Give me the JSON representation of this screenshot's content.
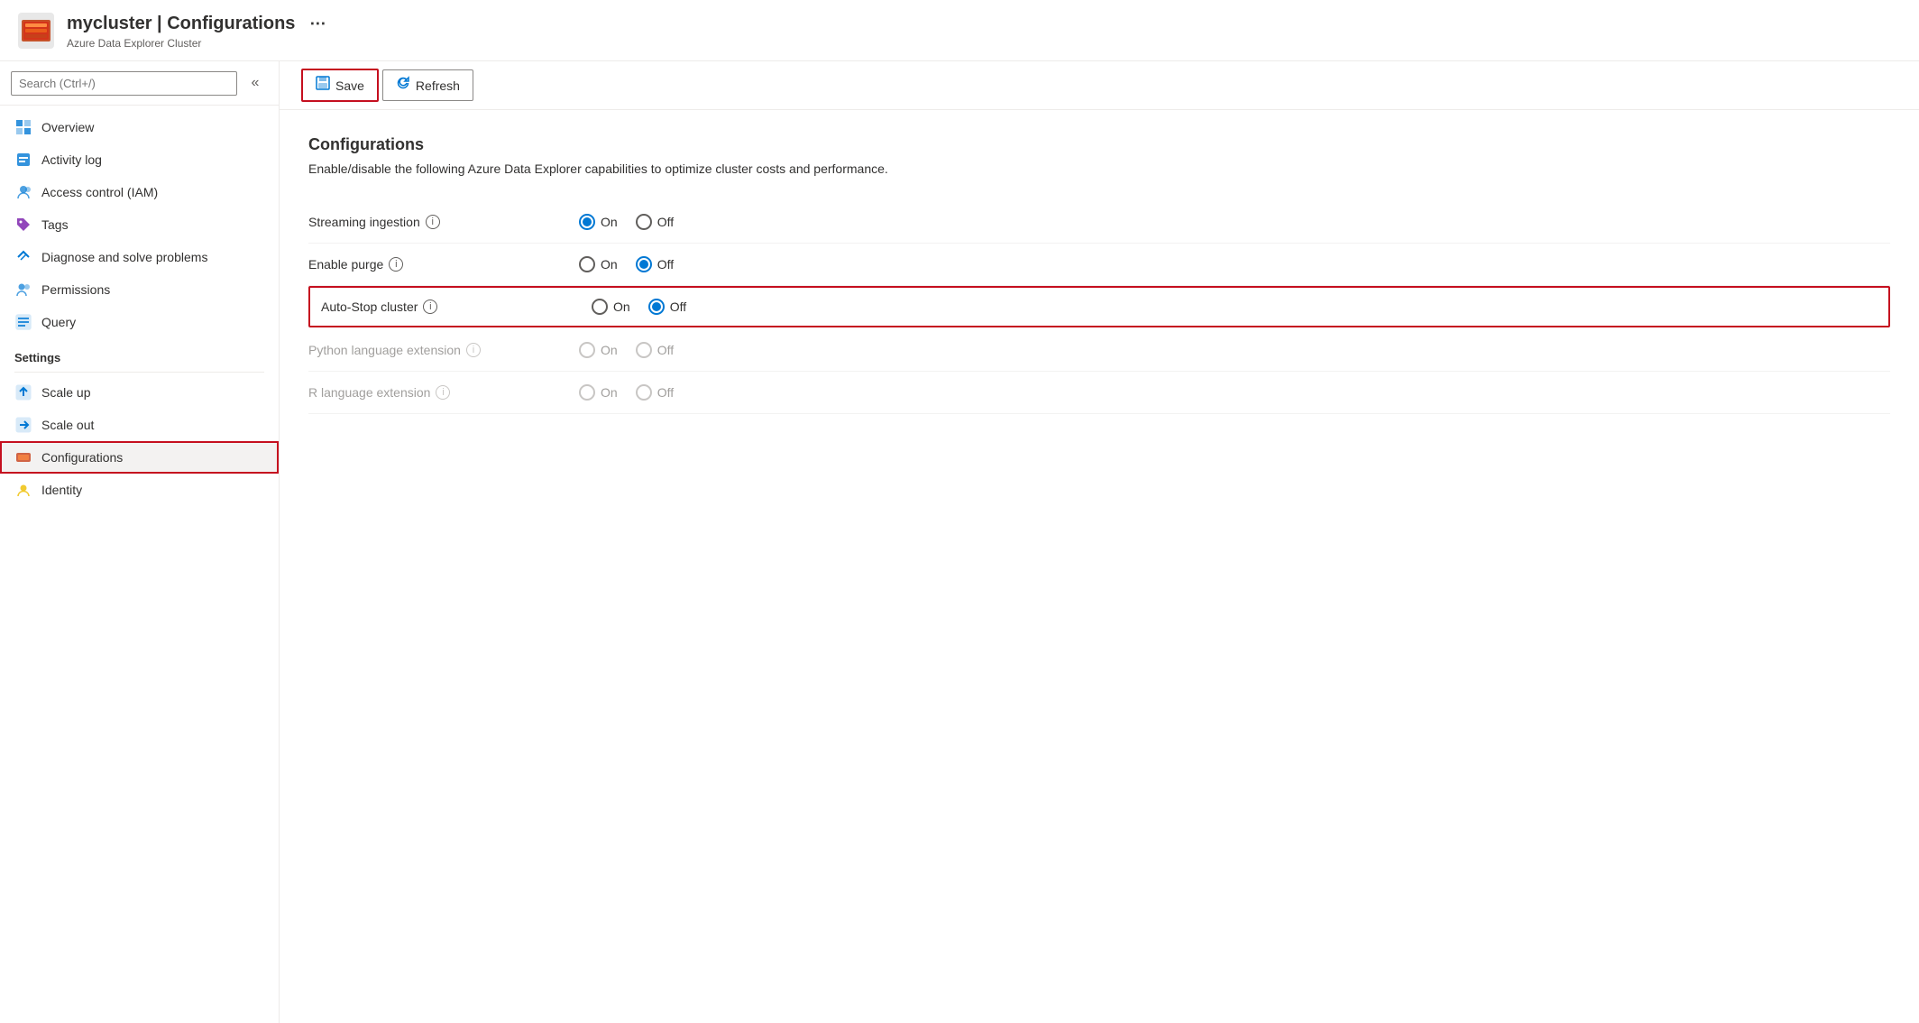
{
  "header": {
    "title": "mycluster | Configurations",
    "subtitle": "Azure Data Explorer Cluster",
    "more_icon": "⋯"
  },
  "sidebar": {
    "search_placeholder": "Search (Ctrl+/)",
    "collapse_icon": "«",
    "nav_items": [
      {
        "id": "overview",
        "label": "Overview",
        "icon": "overview"
      },
      {
        "id": "activity-log",
        "label": "Activity log",
        "icon": "activity"
      },
      {
        "id": "access-control",
        "label": "Access control (IAM)",
        "icon": "access"
      },
      {
        "id": "tags",
        "label": "Tags",
        "icon": "tags"
      },
      {
        "id": "diagnose",
        "label": "Diagnose and solve problems",
        "icon": "diagnose"
      },
      {
        "id": "permissions",
        "label": "Permissions",
        "icon": "permissions"
      },
      {
        "id": "query",
        "label": "Query",
        "icon": "query"
      }
    ],
    "settings_label": "Settings",
    "settings_items": [
      {
        "id": "scale-up",
        "label": "Scale up",
        "icon": "scale-up"
      },
      {
        "id": "scale-out",
        "label": "Scale out",
        "icon": "scale-out"
      },
      {
        "id": "configurations",
        "label": "Configurations",
        "icon": "configurations",
        "active": true
      },
      {
        "id": "identity",
        "label": "Identity",
        "icon": "identity"
      }
    ]
  },
  "toolbar": {
    "save_label": "Save",
    "refresh_label": "Refresh"
  },
  "config": {
    "title": "Configurations",
    "description": "Enable/disable the following Azure Data Explorer capabilities to optimize cluster costs and performance.",
    "rows": [
      {
        "id": "streaming-ingestion",
        "label": "Streaming ingestion",
        "has_info": true,
        "on_selected": true,
        "off_selected": false,
        "disabled": false
      },
      {
        "id": "enable-purge",
        "label": "Enable purge",
        "has_info": true,
        "on_selected": false,
        "off_selected": true,
        "disabled": false
      },
      {
        "id": "auto-stop",
        "label": "Auto-Stop cluster",
        "has_info": true,
        "on_selected": false,
        "off_selected": true,
        "disabled": false,
        "highlighted": true
      },
      {
        "id": "python-extension",
        "label": "Python language extension",
        "has_info": true,
        "on_selected": false,
        "off_selected": false,
        "disabled": true
      },
      {
        "id": "r-extension",
        "label": "R language extension",
        "has_info": true,
        "on_selected": false,
        "off_selected": false,
        "disabled": true
      }
    ]
  }
}
